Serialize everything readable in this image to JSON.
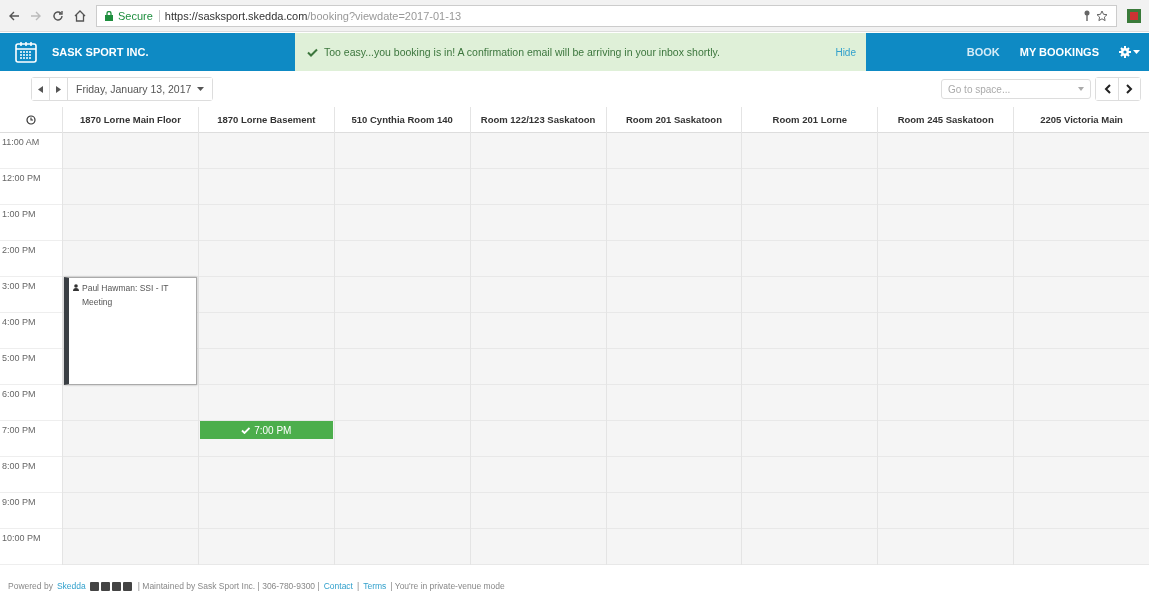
{
  "browser": {
    "secure_label": "Secure",
    "url_host": "https://sasksport.skedda.com",
    "url_path": "/booking?viewdate=2017-01-13"
  },
  "header": {
    "brand": "SASK SPORT INC.",
    "alert": {
      "message": "Too easy...you booking is in! A confirmation email will be arriving in your inbox shortly.",
      "action": "Hide"
    },
    "nav": [
      "BOOK",
      "MY BOOKINGS"
    ]
  },
  "toolbar": {
    "date": "Friday, January 13, 2017",
    "space_search": {
      "placeholder": "Go to space..."
    }
  },
  "time_rows": [
    "11:00 AM",
    "12:00 PM",
    "1:00 PM",
    "2:00 PM",
    "3:00 PM",
    "4:00 PM",
    "5:00 PM",
    "6:00 PM",
    "7:00 PM",
    "8:00 PM",
    "9:00 PM",
    "10:00 PM"
  ],
  "columns": [
    {
      "name": "1870 Lorne Main Floor",
      "bookings": [
        {
          "kind": "event",
          "title": "Paul Hawman: SSI - IT Meeting"
        }
      ]
    },
    {
      "name": "1870 Lorne Basement",
      "bookings": [
        {
          "kind": "new",
          "title": "7:00 PM"
        }
      ]
    },
    {
      "name": "510 Cynthia Room 140"
    },
    {
      "name": "Room 122/123 Saskatoon"
    },
    {
      "name": "Room 201 Saskatoon"
    },
    {
      "name": "Room 201 Lorne"
    },
    {
      "name": "Room 245 Saskatoon"
    },
    {
      "name": "2205 Victoria Main"
    }
  ],
  "footer": [
    {
      "kind": "text",
      "text": "Powered by"
    },
    {
      "kind": "link",
      "text": "Skedda"
    },
    {
      "kind": "social"
    },
    {
      "kind": "text",
      "text": "| Maintained by Sask Sport Inc. | 306-780-9300 |"
    },
    {
      "kind": "link",
      "text": "Contact"
    },
    {
      "kind": "text",
      "text": "|"
    },
    {
      "kind": "link",
      "text": "Terms"
    },
    {
      "kind": "text",
      "text": "| You're in private-venue mode"
    }
  ]
}
